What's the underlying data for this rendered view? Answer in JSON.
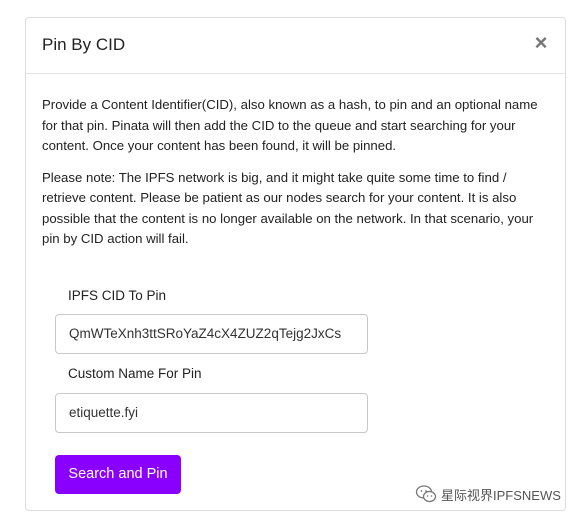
{
  "modal": {
    "title": "Pin By CID",
    "close_icon": "×",
    "description": "Provide a Content Identifier(CID), also known as a hash, to pin and an optional name for that pin. Pinata will then add the CID to the queue and start searching for your content. Once your content has been found, it will be pinned.",
    "note": "Please note: The IPFS network is big, and it might take quite some time to find / retrieve content. Please be patient as our nodes search for your content. It is also possible that the content is no longer available on the network. In that scenario, your pin by CID action will fail.",
    "cid_label": "IPFS CID To Pin",
    "cid_value": "QmWTeXnh3ttSRoYaZ4cX4ZUZ2qTejg2JxCs",
    "name_label": "Custom Name For Pin",
    "name_value": "etiquette.fyi",
    "submit_label": "Search and Pin"
  },
  "watermark": {
    "text": "星际视界IPFSNEWS",
    "icon": "wechat-icon"
  },
  "colors": {
    "accent": "#8a00ff",
    "border": "#dcdcdc"
  }
}
